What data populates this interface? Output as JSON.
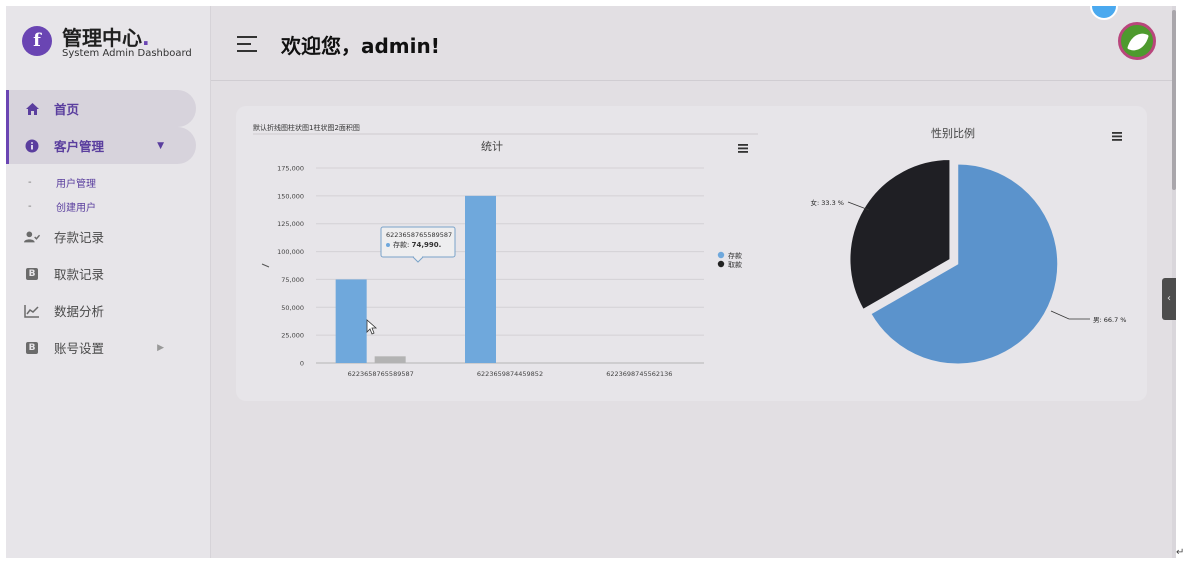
{
  "brand": {
    "logo_letter": "f",
    "title": "管理中心",
    "title_dot": ".",
    "subtitle": "System Admin Dashboard"
  },
  "header": {
    "welcome": "欢迎您，admin!"
  },
  "nav": {
    "home": "首页",
    "customer": "客户管理",
    "sub_user_manage": "用户管理",
    "sub_create_user": "创建用户",
    "deposit": "存款记录",
    "withdraw": "取款记录",
    "analysis": "数据分析",
    "account": "账号设置",
    "badge_letter": "B"
  },
  "card": {
    "switch_hint": "默认折线图柱状图1柱状图2面积图"
  },
  "chart_data": [
    {
      "type": "bar",
      "title": "统计",
      "categories": [
        "6223658765589587",
        "6223659874459852",
        "6223698745562136"
      ],
      "series": [
        {
          "name": "存款",
          "values": [
            74990,
            150000,
            0
          ],
          "color": "#6fa8dc"
        },
        {
          "name": "取款",
          "values": [
            0,
            0,
            0
          ],
          "color": "#222222"
        }
      ],
      "extra_grey_bar": {
        "category_index": 0,
        "value": 6000,
        "color": "#b3b3b3"
      },
      "ylim": [
        0,
        175000
      ],
      "yticks": [
        "175,000",
        "150,000",
        "125,000",
        "100,000",
        "75,000",
        "50,000",
        "25,000",
        "0"
      ],
      "grid": true,
      "legend": "right",
      "tooltip": {
        "category": "6223658765589587",
        "series": "存款",
        "value": "74,990."
      }
    },
    {
      "type": "pie",
      "title": "性别比例",
      "slices": [
        {
          "label": "男",
          "value": 66.7,
          "display": "男: 66.7 %",
          "color": "#5b93cc"
        },
        {
          "label": "女",
          "value": 33.3,
          "display": "女: 33.3 %",
          "color": "#1f1f24"
        }
      ]
    }
  ],
  "colors": {
    "accent": "#6a45b3",
    "background": "#e2dfe3"
  }
}
